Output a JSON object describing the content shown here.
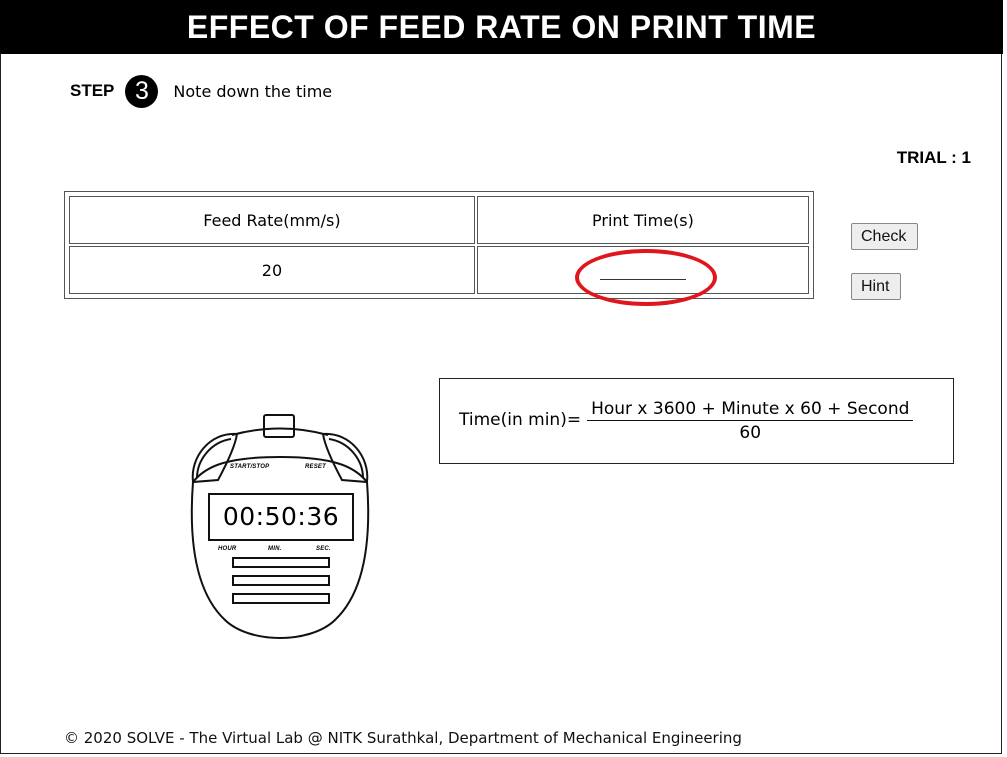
{
  "header": {
    "title": "EFFECT OF FEED RATE ON PRINT TIME"
  },
  "step": {
    "label": "STEP",
    "number": "3",
    "instruction": "Note down the time"
  },
  "trial": {
    "text": "TRIAL : 1"
  },
  "table": {
    "headers": [
      "Feed Rate(mm/s)",
      "Print Time(s)"
    ],
    "row": {
      "feed_rate": "20",
      "print_time_value": ""
    }
  },
  "buttons": {
    "check": "Check",
    "hint": "Hint"
  },
  "formula": {
    "lhs": "Time(in min)=",
    "numerator": "Hour x 3600 + Minute x 60 + Second",
    "denominator": "60"
  },
  "stopwatch": {
    "display": "00:50:36",
    "start_stop_label": "START/STOP",
    "reset_label": "RESET",
    "hour_label": "HOUR",
    "min_label": "MIN.",
    "sec_label": "SEC."
  },
  "highlight_color": "#e0161e",
  "footer": {
    "text": "© 2020 SOLVE - The Virtual Lab @ NITK Surathkal, Department of Mechanical Engineering"
  }
}
